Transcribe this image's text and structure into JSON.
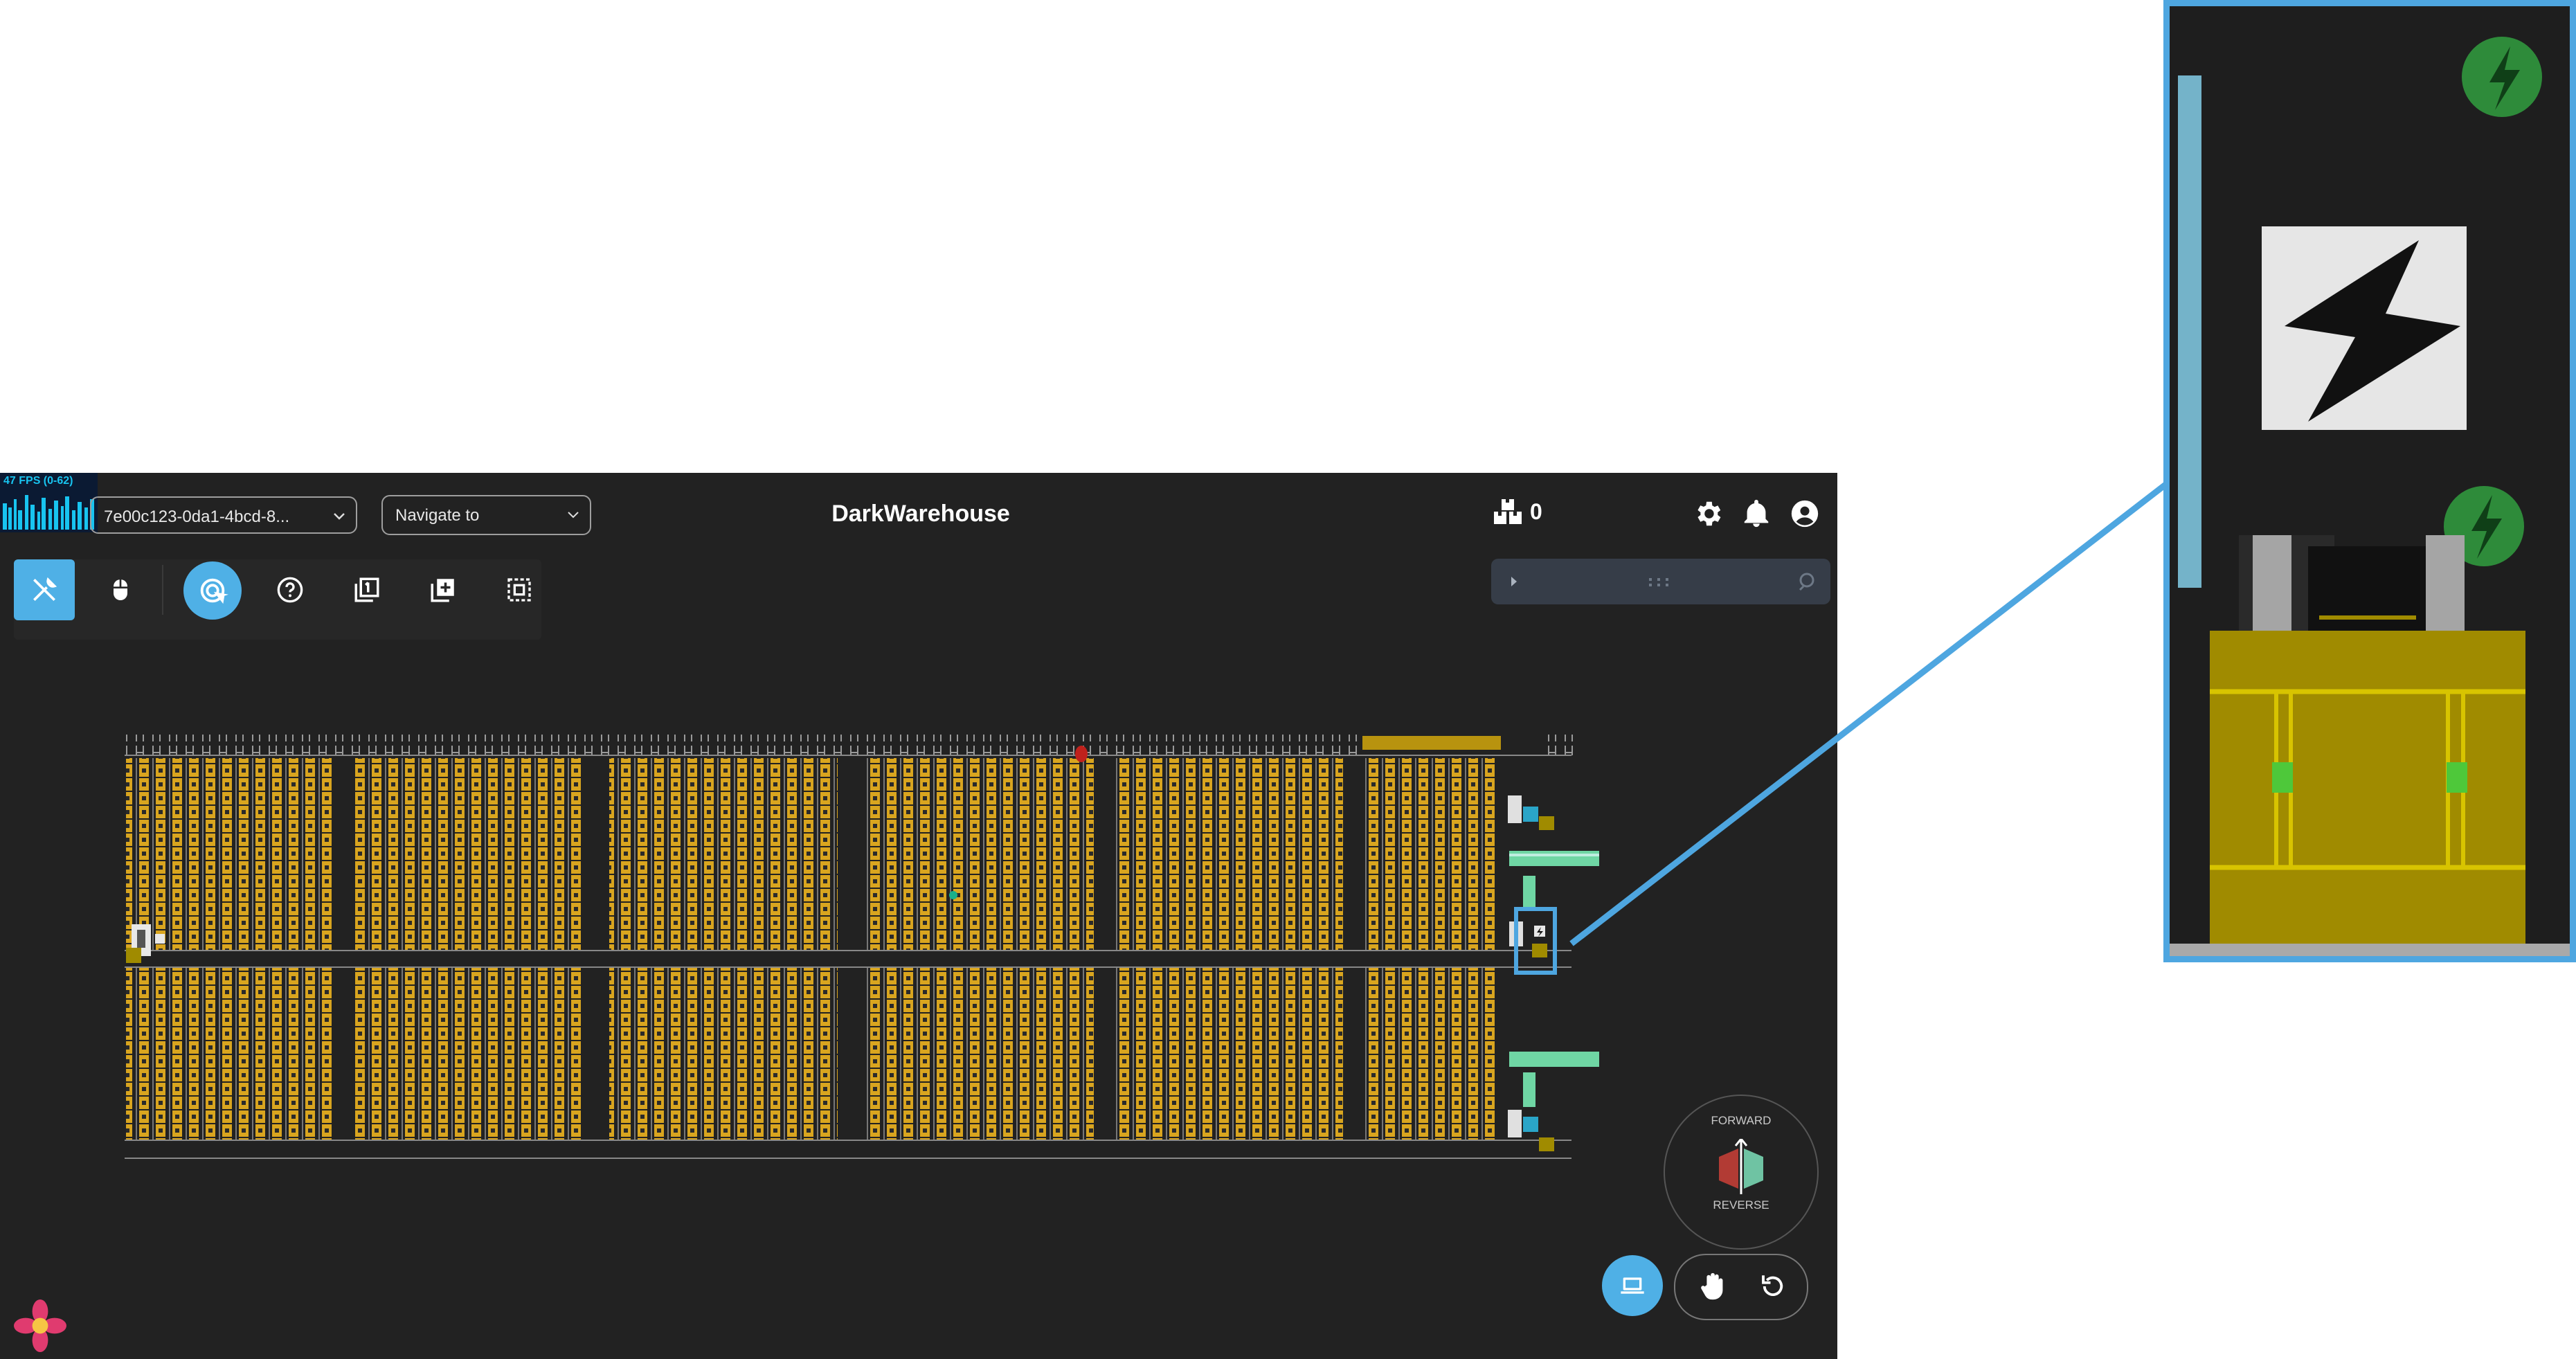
{
  "fps": {
    "label": "47 FPS (0-62)"
  },
  "header": {
    "session_id": "7e00c123-0da1-4bcd-8...",
    "navigate_placeholder": "Navigate to",
    "title": "DarkWarehouse",
    "box_count": "0"
  },
  "toolbar": {
    "tools": [
      "tools-icon",
      "mouse-icon",
      "target-icon",
      "help-icon",
      "page-one-icon",
      "add-layer-icon",
      "select-area-icon"
    ],
    "active": "target-icon"
  },
  "dial": {
    "forward_label": "FORWARD",
    "reverse_label": "REVERSE"
  },
  "controls": [
    "screen-icon",
    "hand-icon",
    "reset-icon"
  ],
  "colors": {
    "accent": "#4fb0e6",
    "background": "#222222",
    "storage": "#d9a51f",
    "conveyor": "#6fd6a4",
    "robot_body": "#a08b00",
    "charge": "#2e8b3a"
  }
}
